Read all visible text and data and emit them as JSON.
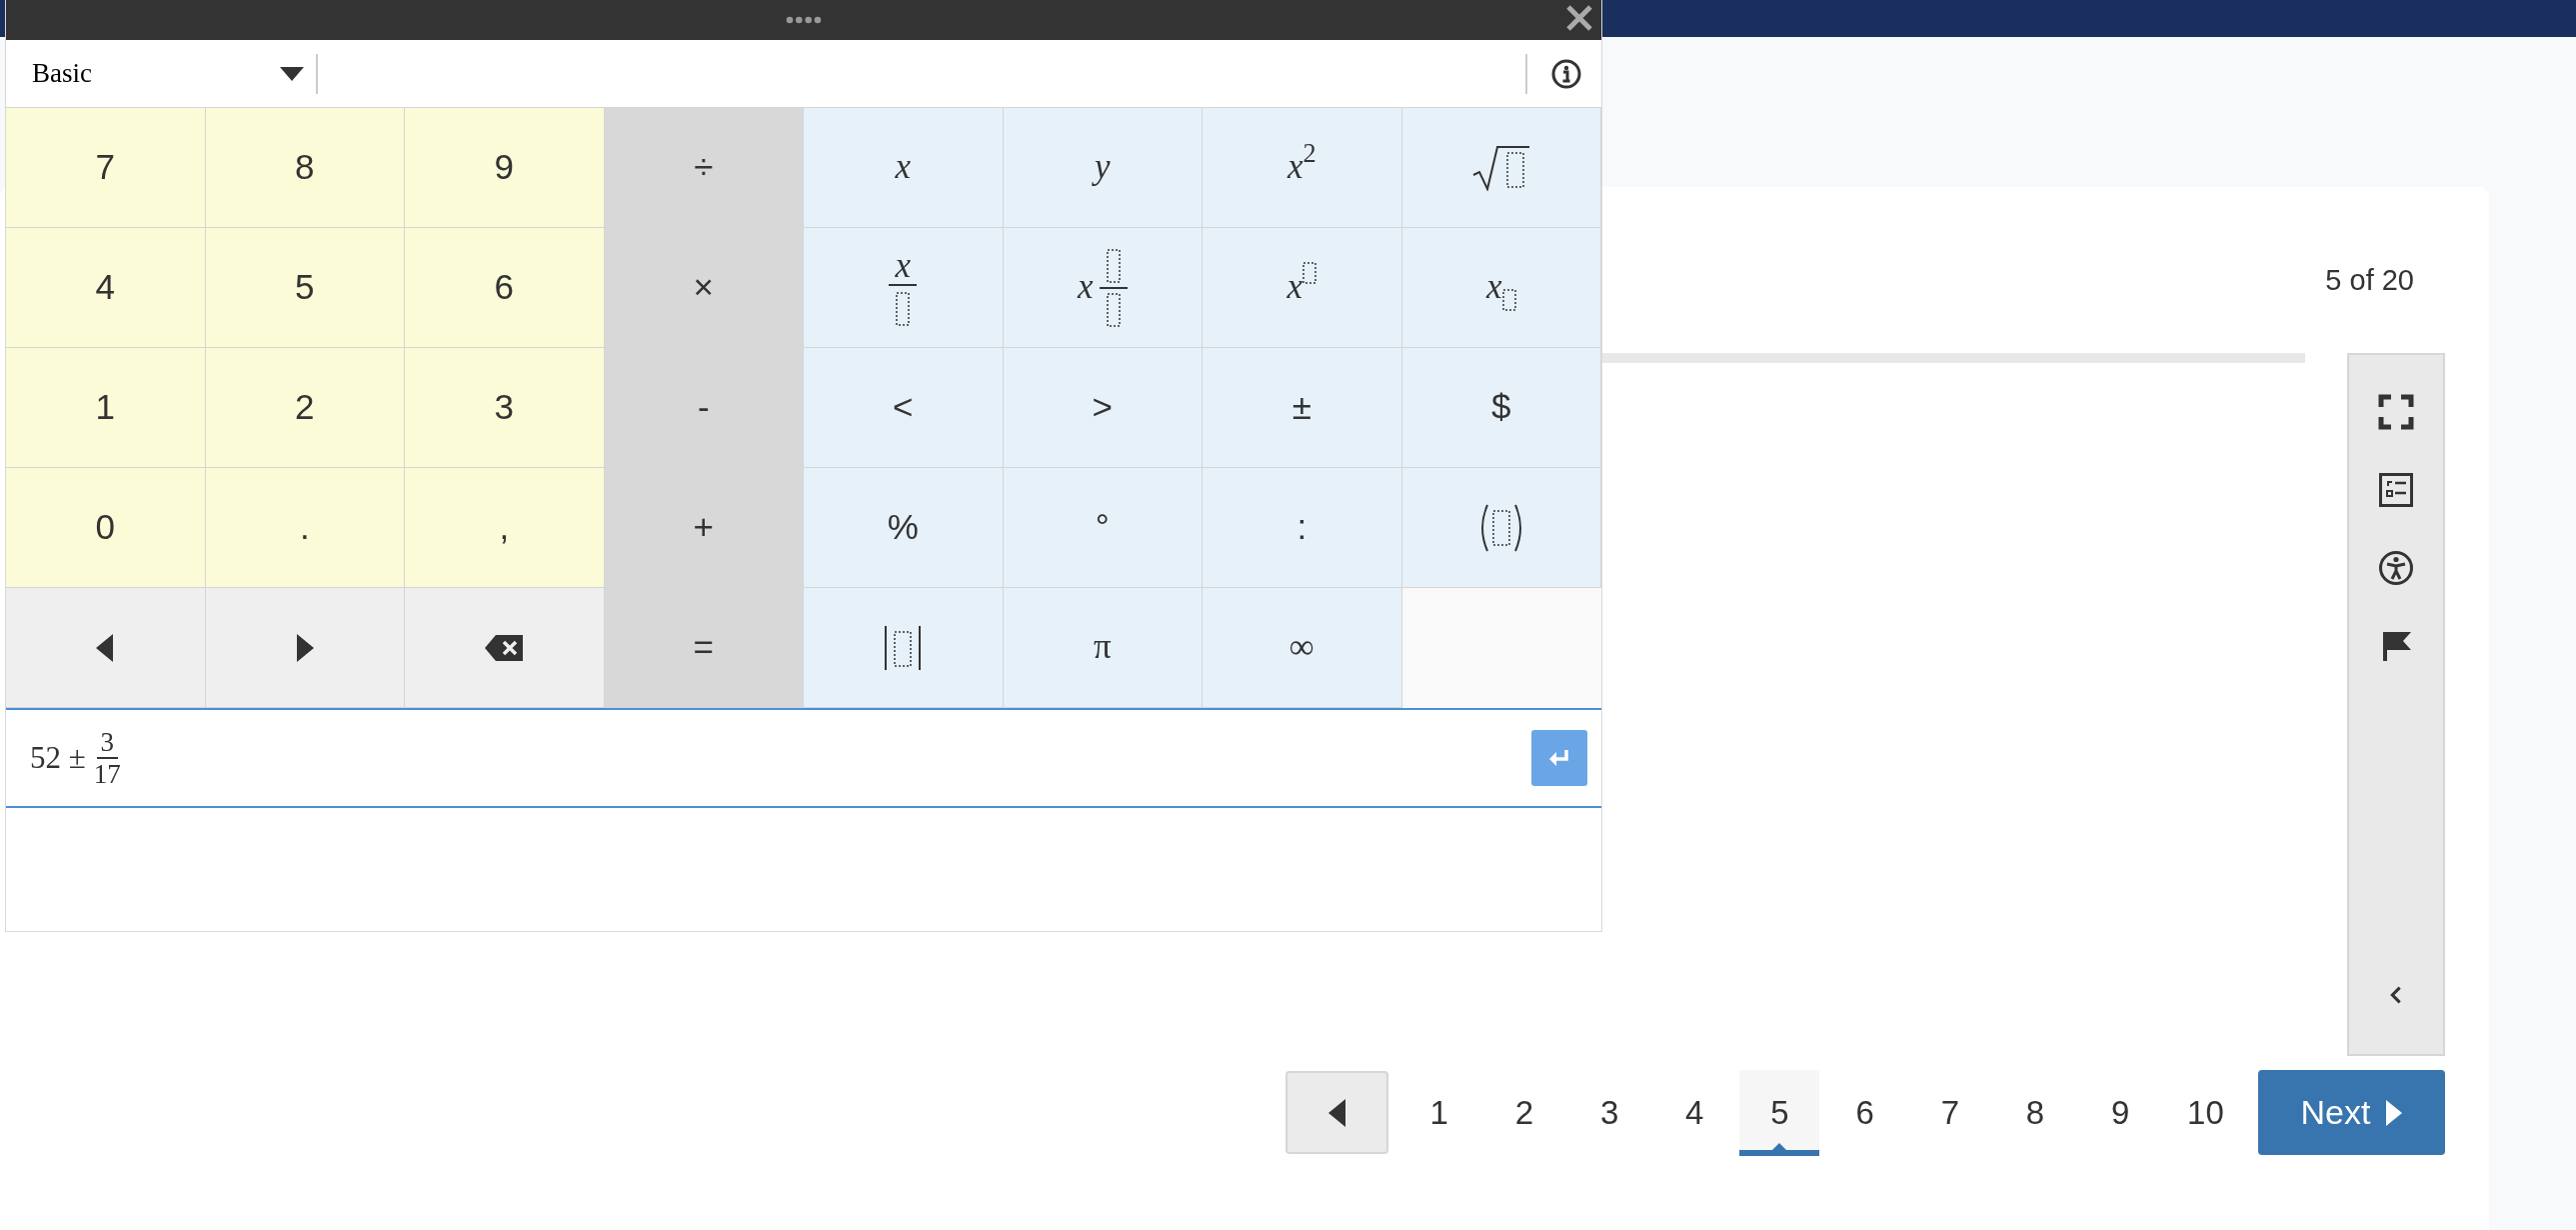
{
  "calculator": {
    "mode": "Basic",
    "keys": [
      {
        "label": "7",
        "color": "#fbfbd7",
        "kind": "text"
      },
      {
        "label": "8",
        "color": "#fbfbd7",
        "kind": "text"
      },
      {
        "label": "9",
        "color": "#fbfbd7",
        "kind": "text"
      },
      {
        "label": "÷",
        "color": "#d8d8d8",
        "kind": "text"
      },
      {
        "label": "x",
        "color": "#e6f1fa",
        "kind": "variable"
      },
      {
        "label": "y",
        "color": "#e6f1fa",
        "kind": "variable"
      },
      {
        "label": "*x*$^{2}$",
        "color": "#e6f1fa",
        "kind": "math"
      },
      {
        "color": "#e6f1fa",
        "kind": "sqrt"
      },
      {
        "label": "4",
        "color": "#fbfbd7",
        "kind": "text"
      },
      {
        "label": "5",
        "color": "#fbfbd7",
        "kind": "text"
      },
      {
        "label": "6",
        "color": "#fbfbd7",
        "kind": "text"
      },
      {
        "label": "×",
        "color": "#d8d8d8",
        "kind": "text"
      },
      {
        "label": "x",
        "color": "#e6f1fa",
        "kind": "fraction"
      },
      {
        "label": "x",
        "color": "#e6f1fa",
        "kind": "mixed"
      },
      {
        "label": "x",
        "color": "#e6f1fa",
        "kind": "power"
      },
      {
        "label": "x",
        "color": "#e6f1fa",
        "kind": "subscript"
      },
      {
        "label": "1",
        "color": "#fbfbd7",
        "kind": "text"
      },
      {
        "label": "2",
        "color": "#fbfbd7",
        "kind": "text"
      },
      {
        "label": "3",
        "color": "#fbfbd7",
        "kind": "text"
      },
      {
        "label": "-",
        "color": "#d8d8d8",
        "kind": "text"
      },
      {
        "label": "<",
        "color": "#e6f1fa",
        "kind": "text"
      },
      {
        "label": ">",
        "color": "#e6f1fa",
        "kind": "text"
      },
      {
        "label": "±",
        "color": "#e6f1fa",
        "kind": "text"
      },
      {
        "label": "$",
        "color": "#e6f1fa",
        "kind": "text"
      },
      {
        "label": "0",
        "color": "#fbfbd7",
        "kind": "text"
      },
      {
        "label": ".",
        "color": "#fbfbd7",
        "kind": "text"
      },
      {
        "label": ",",
        "color": "#fbfbd7",
        "kind": "text"
      },
      {
        "label": "+",
        "color": "#d8d8d8",
        "kind": "text"
      },
      {
        "label": "%",
        "color": "#e6f1fa",
        "kind": "text"
      },
      {
        "label": "°",
        "color": "#e6f1fa",
        "kind": "text"
      },
      {
        "label": ":",
        "color": "#e6f1fa",
        "kind": "text"
      },
      {
        "color": "#e6f1fa",
        "kind": "parens"
      },
      {
        "color": "#efefef",
        "kind": "left"
      },
      {
        "color": "#efefef",
        "kind": "right"
      },
      {
        "color": "#efefef",
        "kind": "backspace"
      },
      {
        "label": "=",
        "color": "#d8d8d8",
        "kind": "text"
      },
      {
        "color": "#e6f1fa",
        "kind": "abs"
      },
      {
        "label": "π",
        "color": "#e6f1fa",
        "kind": "math"
      },
      {
        "label": "∞",
        "color": "#e6f1fa",
        "kind": "math"
      }
    ],
    "answer": {
      "whole": "52 ±",
      "numerator": "3",
      "denominator": "17"
    }
  },
  "question_counter": "5 of 20",
  "pages": [
    {
      "label": "1",
      "selected": false
    },
    {
      "label": "2",
      "selected": false
    },
    {
      "label": "3",
      "selected": false
    },
    {
      "label": "4",
      "selected": false
    },
    {
      "label": "5",
      "selected": true
    },
    {
      "label": "6",
      "selected": false
    },
    {
      "label": "7",
      "selected": false
    },
    {
      "label": "8",
      "selected": false
    },
    {
      "label": "9",
      "selected": false
    },
    {
      "label": "10",
      "selected": false
    }
  ],
  "next_button": "Next"
}
